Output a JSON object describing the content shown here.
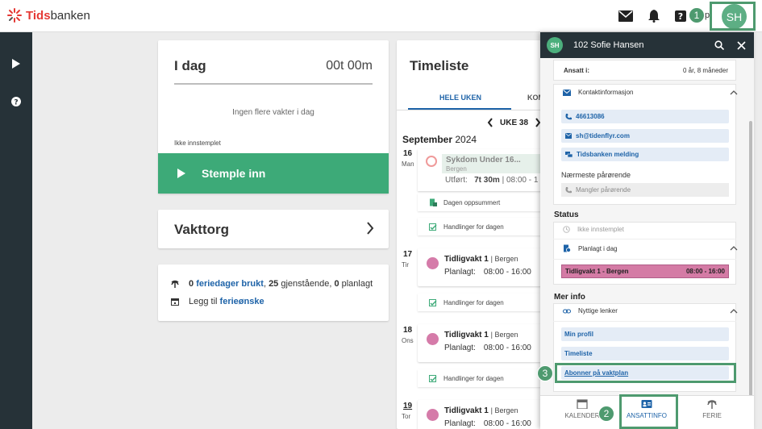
{
  "app": {
    "logo_prefix": "Tids",
    "logo_suffix": "banken",
    "user_initials": "SH",
    "header_trailing": "p"
  },
  "today_card": {
    "title": "I dag",
    "time": "00t 00m",
    "no_more": "Ingen flere vakter i dag",
    "status": "Ikke innstemplet",
    "clock_in_label": "Stemple inn"
  },
  "vakttorg": {
    "title": "Vakttorg"
  },
  "ferie": {
    "used_count": "0",
    "used_label": "feriedager brukt",
    "remaining_count": "25",
    "remaining_label": "gjenstående,",
    "planned_count": "0",
    "planned_label": "planlagt",
    "add_prefix": "Legg til",
    "add_link": "ferieønske"
  },
  "timeliste": {
    "title": "Timeliste",
    "tab_week": "HELE UKEN",
    "tab_next": "KOM",
    "week": "UKE 38",
    "month": "September",
    "year": "2024",
    "days": [
      {
        "num": "16",
        "name": "Man",
        "sick_title": "Sykdom Under 16...",
        "sick_loc": "Bergen",
        "done_label": "Utført:",
        "done_value": "7t 30m",
        "done_range": "| 08:00 - 1",
        "summary": "Dagen oppsummert",
        "actions": "Handlinger for dagen"
      },
      {
        "num": "17",
        "name": "Tir",
        "shift_name": "Tidligvakt 1",
        "shift_loc": "| Bergen",
        "plan_label": "Planlagt:",
        "plan_time": "08:00 - 16:00",
        "actions": "Handlinger for dagen"
      },
      {
        "num": "18",
        "name": "Ons",
        "shift_name": "Tidligvakt 1",
        "shift_loc": "| Bergen",
        "plan_label": "Planlagt:",
        "plan_time": "08:00 - 16:00",
        "actions": "Handlinger for dagen"
      },
      {
        "num": "19",
        "name": "Tor",
        "shift_name": "Tidligvakt 1",
        "shift_loc": "| Bergen",
        "plan_label": "Planlagt:",
        "plan_time": "08:00 - 16:00"
      }
    ]
  },
  "panel": {
    "title": "102 Sofie Hansen",
    "avatar": "SH",
    "employed_label": "Ansatt i:",
    "employed_value": "0 år, 8 måneder",
    "contact_label": "Kontaktinformasjon",
    "phone": "46613086",
    "email": "sh@tidenflyr.com",
    "message": "Tidsbanken melding",
    "relatives_label": "Nærmeste pårørende",
    "relatives_value": "Mangler pårørende",
    "status_heading": "Status",
    "status_value": "Ikke innstemplet",
    "planned_label": "Planlagt i dag",
    "planned_shift": "Tidligvakt 1 - Bergen",
    "planned_time": "08:00 - 16:00",
    "more_heading": "Mer info",
    "links_label": "Nyttige lenker",
    "links": [
      "Min profil",
      "Timeliste",
      "Abonner på vaktplan"
    ]
  },
  "bottom_nav": {
    "calendar": "KALENDER",
    "employee": "ANSATTINFO",
    "vacation": "FERIE"
  },
  "markers": {
    "one": "1",
    "two": "2",
    "three": "3"
  },
  "colors": {
    "accent_green": "#3daa78",
    "dark_nav": "#263238",
    "link_blue": "#1e63a8",
    "shift_pink": "#d47ba5",
    "highlight": "#4e9a6f"
  }
}
